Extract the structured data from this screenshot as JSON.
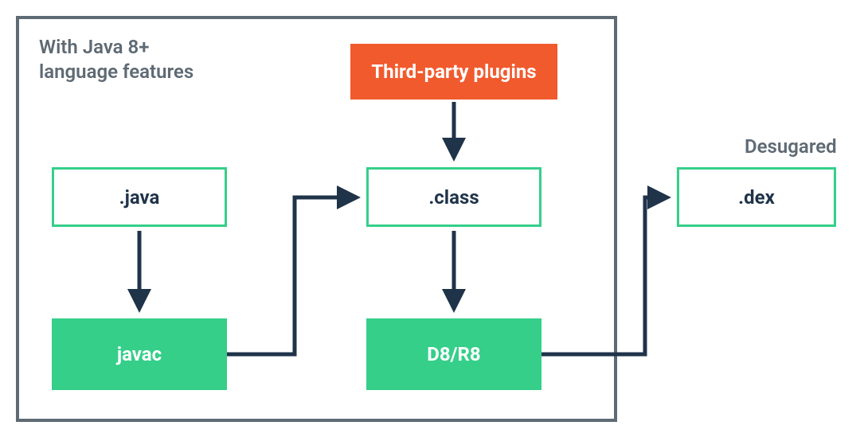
{
  "diagram": {
    "title_line1": "With Java 8+",
    "title_line2": "language features",
    "nodes": {
      "java": ".java",
      "javac": "javac",
      "plugins": "Third-party plugins",
      "class": ".class",
      "d8r8": "D8/R8",
      "dex": ".dex"
    },
    "labels": {
      "desugared": "Desugared"
    },
    "colors": {
      "border_gray": "#5e6a74",
      "green": "#35cf8a",
      "orange": "#f15a2d",
      "dark_navy": "#1f3349"
    }
  },
  "chart_data": {
    "type": "flow-diagram",
    "container_label": "With Java 8+ language features",
    "nodes": [
      {
        "id": "java",
        "label": ".java",
        "style": "outline-green"
      },
      {
        "id": "javac",
        "label": "javac",
        "style": "solid-green"
      },
      {
        "id": "plugins",
        "label": "Third-party plugins",
        "style": "solid-orange"
      },
      {
        "id": "class",
        "label": ".class",
        "style": "outline-green"
      },
      {
        "id": "d8r8",
        "label": "D8/R8",
        "style": "solid-green"
      },
      {
        "id": "dex",
        "label": ".dex",
        "style": "outline-green",
        "annotation": "Desugared"
      }
    ],
    "edges": [
      {
        "from": "java",
        "to": "javac"
      },
      {
        "from": "javac",
        "to": "class"
      },
      {
        "from": "plugins",
        "to": "class"
      },
      {
        "from": "class",
        "to": "d8r8"
      },
      {
        "from": "d8r8",
        "to": "dex"
      }
    ],
    "inside_container": [
      "java",
      "javac",
      "plugins",
      "class",
      "d8r8"
    ],
    "outside_container": [
      "dex"
    ]
  }
}
